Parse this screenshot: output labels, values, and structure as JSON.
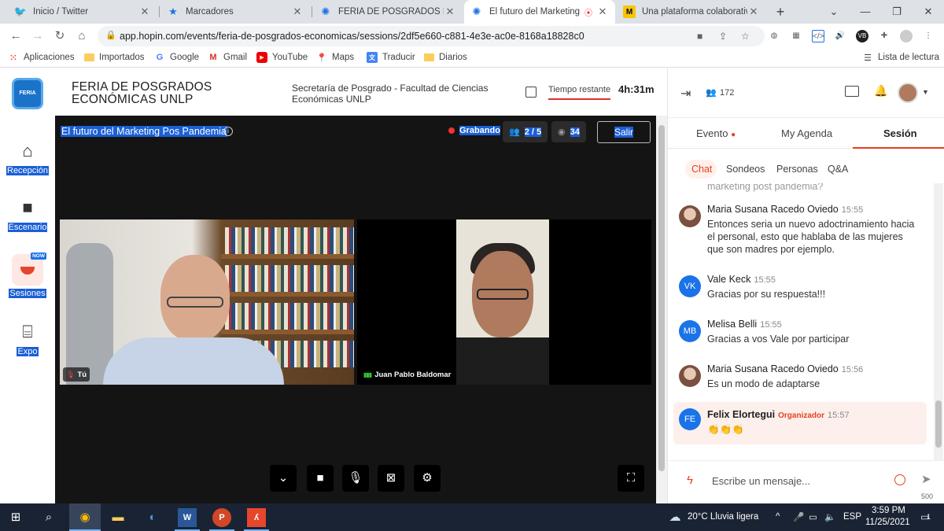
{
  "browser": {
    "tabs": [
      {
        "title": "Inicio / Twitter",
        "icon": "twitter-icon",
        "color": "#1da1f2"
      },
      {
        "title": "Marcadores",
        "icon": "star-icon",
        "color": "#1a73e8"
      },
      {
        "title": "FERIA DE POSGRADOS ECONÓ",
        "icon": "hopin-icon",
        "color": "#1a73e8"
      },
      {
        "title": "El futuro del Marketing P",
        "icon": "hopin-icon",
        "color": "#1a73e8",
        "active": true
      },
      {
        "title": "Una plataforma colaborativa",
        "icon": "miro-icon",
        "color": "#f7c600"
      }
    ],
    "url": "app.hopin.com/events/feria-de-posgrados-economicas/sessions/2df5e660-c881-4e3e-ac0e-8168a18828c0",
    "bookmarks": [
      "Aplicaciones",
      "Importados",
      "Google",
      "Gmail",
      "YouTube",
      "Maps",
      "Traducir",
      "Diarios"
    ],
    "reading_list": "Lista de lectura"
  },
  "nav": {
    "logo_text": "FERIA",
    "items": [
      "Recepción",
      "Escenario",
      "Sesiones",
      "Expo"
    ],
    "now_badge": "NOW"
  },
  "event": {
    "title": "FERIA DE POSGRADOS ECONÓMICAS UNLP",
    "organizer": "Secretaría de Posgrado - Facultad de Ciencias Económicas UNLP",
    "time_label": "Tiempo restante",
    "time_value": "4h:31m"
  },
  "stage": {
    "title": "El futuro del Marketing Pos Pandemia",
    "recording": "Grabando",
    "participants": "2 / 5",
    "viewers": "34",
    "leave": "Salir",
    "tiles": [
      {
        "name": "Tú",
        "muted": true
      },
      {
        "name": "Juan Pablo Baldomar",
        "muted": false
      }
    ]
  },
  "panel": {
    "attendees": "172",
    "tabs": [
      "Evento",
      "My Agenda",
      "Sesión"
    ],
    "selected_tab": "Sesión",
    "subtabs": [
      "Chat",
      "Sondeos",
      "Personas",
      "Q&A"
    ],
    "selected_subtab": "Chat",
    "cut_text": "marketing post pandemia?",
    "messages": [
      {
        "name": "Maria Susana Racedo Oviedo",
        "time": "15:55",
        "text": "Entonces seria un nuevo adoctrinamiento hacia el personal, esto que hablaba de las mujeres que son madres por ejemplo.",
        "initials": "",
        "role": ""
      },
      {
        "name": "Vale Keck",
        "time": "15:55",
        "text": "Gracias por su respuesta!!!",
        "initials": "VK",
        "role": ""
      },
      {
        "name": "Melisa Belli",
        "time": "15:55",
        "text": "Gracias a vos Vale por participar",
        "initials": "MB",
        "role": ""
      },
      {
        "name": "Maria Susana Racedo Oviedo",
        "time": "15:56",
        "text": "Es un modo de adaptarse",
        "initials": "",
        "role": ""
      },
      {
        "name": "Felix Elortegui",
        "time": "15:57",
        "text": "👏👏👏",
        "initials": "FE",
        "role": "Organizador"
      }
    ],
    "composer_placeholder": "Escribe un mensaje...",
    "char_limit": "500"
  },
  "taskbar": {
    "weather": "20°C  Lluvia ligera",
    "lang": "ESP",
    "time": "3:59 PM",
    "date": "11/25/2021",
    "notifications": "1"
  }
}
